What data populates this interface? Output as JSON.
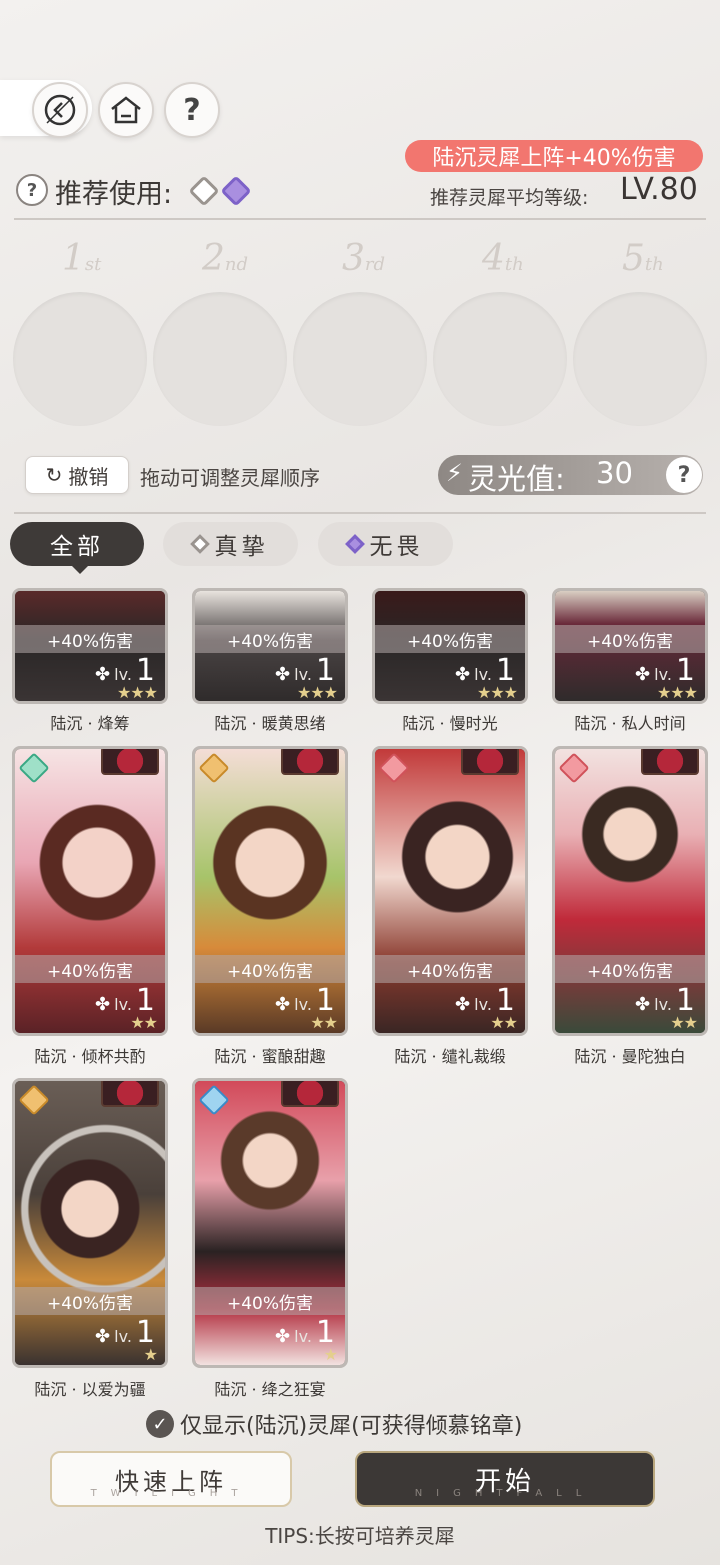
{
  "nav": {
    "help_label": "?"
  },
  "bonus": "陆沉灵犀上阵+40%伤害",
  "recommend": {
    "help": "?",
    "label": "推荐使用:",
    "avg_level_label": "推荐灵犀平均等级:",
    "avg_level_value": "LV.80"
  },
  "slots": [
    {
      "num": "1",
      "suffix": "st"
    },
    {
      "num": "2",
      "suffix": "nd"
    },
    {
      "num": "3",
      "suffix": "rd"
    },
    {
      "num": "4",
      "suffix": "th"
    },
    {
      "num": "5",
      "suffix": "th"
    }
  ],
  "controls": {
    "undo_label": "撤销",
    "hint": "拖动可调整灵犀顺序",
    "energy_label": "灵光值:",
    "energy_value": "30",
    "energy_help": "?"
  },
  "tabs": [
    {
      "label": "全部"
    },
    {
      "label": "真挚"
    },
    {
      "label": "无畏"
    }
  ],
  "cards": [
    {
      "name": "陆沉 · 烽筹",
      "bonus": "+40%伤害",
      "lv_label": "lv.",
      "level": "1",
      "stars": "★★★"
    },
    {
      "name": "陆沉 · 暖黄思绪",
      "bonus": "+40%伤害",
      "lv_label": "lv.",
      "level": "1",
      "stars": "★★★"
    },
    {
      "name": "陆沉 · 慢时光",
      "bonus": "+40%伤害",
      "lv_label": "lv.",
      "level": "1",
      "stars": "★★★"
    },
    {
      "name": "陆沉 · 私人时间",
      "bonus": "+40%伤害",
      "lv_label": "lv.",
      "level": "1",
      "stars": "★★★"
    },
    {
      "name": "陆沉 · 倾杯共酌",
      "bonus": "+40%伤害",
      "lv_label": "lv.",
      "level": "1",
      "stars": "★★"
    },
    {
      "name": "陆沉 · 蜜酿甜趣",
      "bonus": "+40%伤害",
      "lv_label": "lv.",
      "level": "1",
      "stars": "★★"
    },
    {
      "name": "陆沉 · 缱礼裁缎",
      "bonus": "+40%伤害",
      "lv_label": "lv.",
      "level": "1",
      "stars": "★★"
    },
    {
      "name": "陆沉 · 曼陀独白",
      "bonus": "+40%伤害",
      "lv_label": "lv.",
      "level": "1",
      "stars": "★★"
    },
    {
      "name": "陆沉 · 以爱为疆",
      "bonus": "+40%伤害",
      "lv_label": "lv.",
      "level": "1",
      "stars": "★"
    },
    {
      "name": "陆沉 · 绛之狂宴",
      "bonus": "+40%伤害",
      "lv_label": "lv.",
      "level": "1",
      "stars": "★"
    }
  ],
  "footer": {
    "only_show": "仅显示(陆沉)灵犀(可获得倾慕铭章)",
    "quick_label": "快速上阵",
    "quick_sub": "TWILIGHT",
    "start_label": "开始",
    "start_sub": "NIGHTFALL",
    "tips": "TIPS:长按可培养灵犀"
  },
  "colors": {
    "accent": "#f2766f",
    "dark": "#3e3a38",
    "gold": "#e4cf8d"
  }
}
